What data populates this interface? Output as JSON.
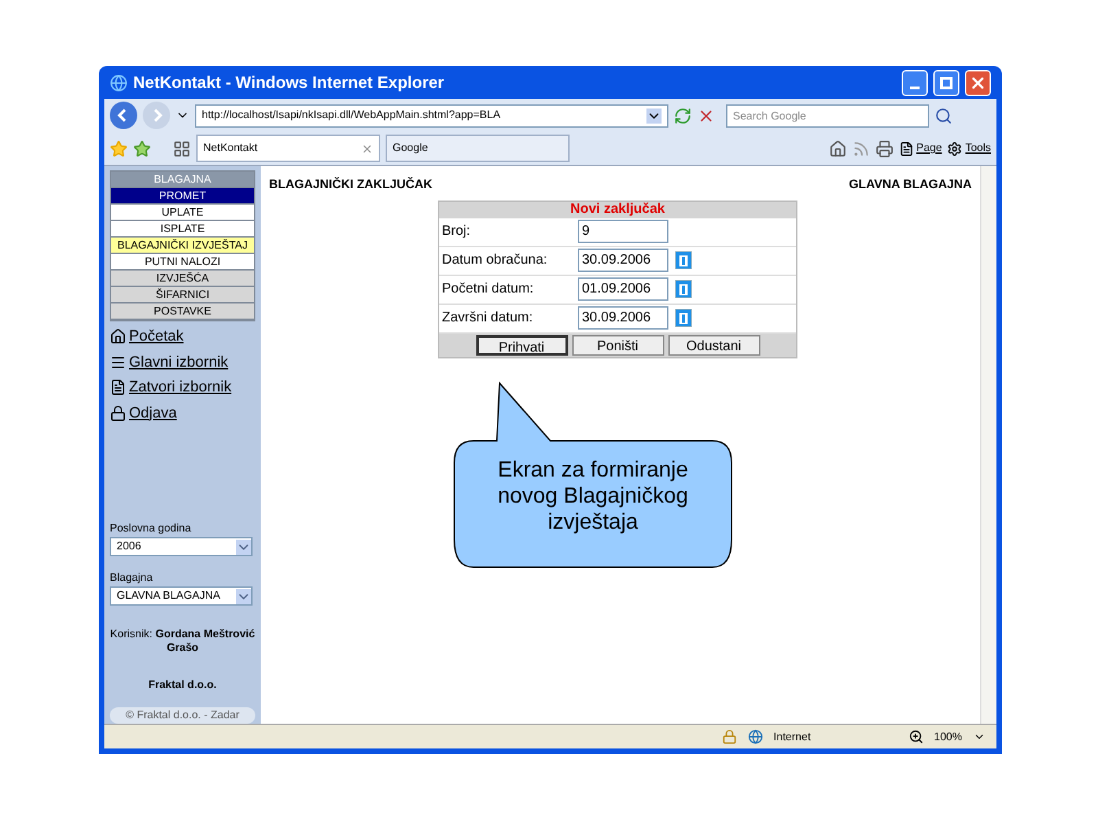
{
  "window": {
    "title": "NetKontakt - Windows Internet Explorer"
  },
  "address": {
    "url": "http://localhost/Isapi/nkIsapi.dll/WebAppMain.shtml?app=BLA"
  },
  "search": {
    "placeholder": "Search Google"
  },
  "tabs": [
    {
      "label": "NetKontakt",
      "selected": true
    },
    {
      "label": "Google",
      "selected": false
    }
  ],
  "commands": [
    "Page",
    "Tools"
  ],
  "sidebar": {
    "items": [
      {
        "kind": "header",
        "label": "BLAGAJNA"
      },
      {
        "kind": "section",
        "label": "PROMET",
        "selected": true
      },
      {
        "kind": "subitem",
        "label": "UPLATE",
        "selected": false
      },
      {
        "kind": "subitem",
        "label": "ISPLATE",
        "selected": false
      },
      {
        "kind": "subitem",
        "label": "BLAGAJNIČKI IZVJEŠTAJ",
        "selected": true
      },
      {
        "kind": "subitem",
        "label": "PUTNI NALOZI",
        "selected": false
      },
      {
        "kind": "section",
        "label": "IZVJEŠĆA",
        "selected": false
      },
      {
        "kind": "section",
        "label": "ŠIFARNICI",
        "selected": false
      },
      {
        "kind": "section",
        "label": "POSTAVKE",
        "selected": false
      }
    ],
    "links": [
      {
        "kind": "home",
        "label": "Početak"
      },
      {
        "kind": "menu",
        "label": "Glavni izbornik"
      },
      {
        "kind": "close",
        "label": "Zatvori izbornik"
      },
      {
        "kind": "lock",
        "label": "Odjava"
      }
    ],
    "year": {
      "label": "Poslovna godina",
      "value": "2006"
    },
    "register": {
      "label": "Blagajna",
      "value": "GLAVNA BLAGAJNA"
    },
    "user": {
      "label": "Korisnik:",
      "name": "Gordana Meštrović Grašo"
    },
    "company": "Fraktal d.o.o.",
    "copyright": "© Fraktal d.o.o. - Zadar"
  },
  "page": {
    "title": "BLAGAJNIČKI ZAKLJUČAK",
    "register": "GLAVNA BLAGAJNA"
  },
  "form": {
    "title": "Novi zaključak",
    "fields": [
      {
        "label": "Broj:",
        "value": "9",
        "calendar": false
      },
      {
        "label": "Datum obračuna:",
        "value": "30.09.2006",
        "calendar": true
      },
      {
        "label": "Početni datum:",
        "value": "01.09.2006",
        "calendar": true
      },
      {
        "label": "Završni datum:",
        "value": "30.09.2006",
        "calendar": true
      }
    ],
    "buttons": [
      "Prihvati",
      "Poništi",
      "Odustani"
    ]
  },
  "callout": {
    "text": "Ekran za formiranje novog Blagajničkog izvještaja"
  },
  "status_bar": {
    "zone": "Internet",
    "zoom": "100%"
  }
}
